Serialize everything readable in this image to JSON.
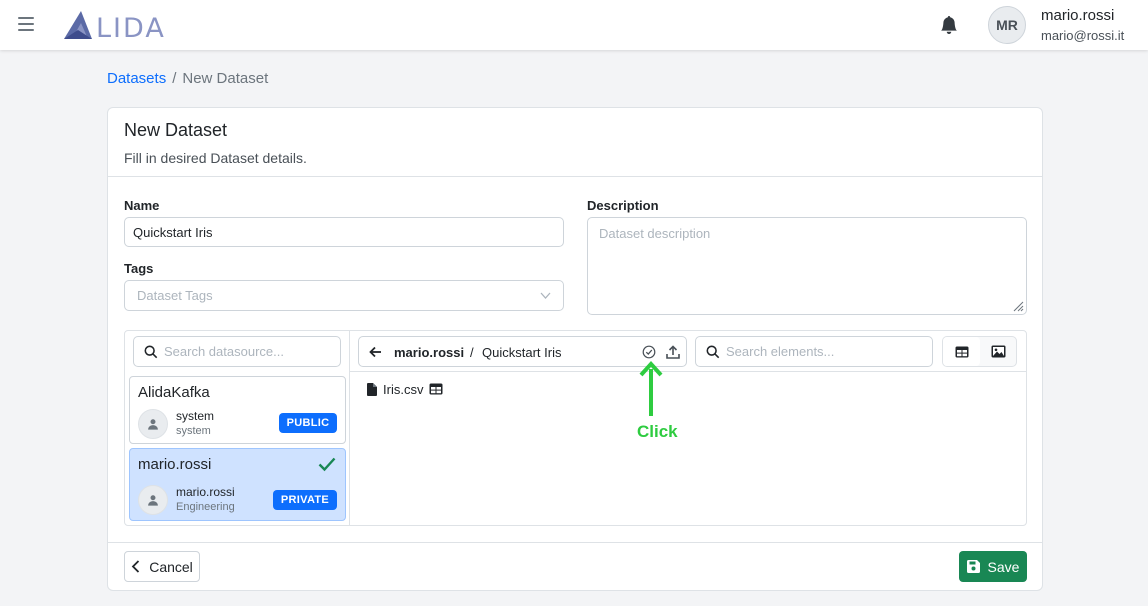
{
  "app": {
    "logo_text": "LIDA"
  },
  "header": {
    "user_initials": "MR",
    "user_name": "mario.rossi",
    "user_email": "mario@rossi.it"
  },
  "breadcrumb": {
    "link": "Datasets",
    "separator": "/",
    "current": "New Dataset"
  },
  "card": {
    "title": "New Dataset",
    "subtitle": "Fill in desired Dataset details."
  },
  "form": {
    "name_label": "Name",
    "name_value": "Quickstart Iris",
    "tags_label": "Tags",
    "tags_placeholder": "Dataset Tags",
    "description_label": "Description",
    "description_placeholder": "Dataset description"
  },
  "datasources": {
    "search_placeholder": "Search datasource...",
    "items": [
      {
        "name": "AlidaKafka",
        "owner": "system",
        "group": "system",
        "badge": "PUBLIC",
        "selected": false
      },
      {
        "name": "mario.rossi",
        "owner": "mario.rossi",
        "group": "Engineering",
        "badge": "PRIVATE",
        "selected": true
      }
    ]
  },
  "browser": {
    "path_owner": "mario.rossi",
    "path_separator": "/",
    "path_name": "Quickstart Iris",
    "search_placeholder": "Search elements...",
    "files": [
      {
        "name": "Iris.csv"
      }
    ]
  },
  "annotation": {
    "label": "Click",
    "color": "#2ecc40"
  },
  "footer": {
    "cancel_label": "Cancel",
    "save_label": "Save"
  },
  "colors": {
    "primary": "#0d6efd",
    "success": "#198754",
    "selected_bg": "#cfe2ff"
  }
}
